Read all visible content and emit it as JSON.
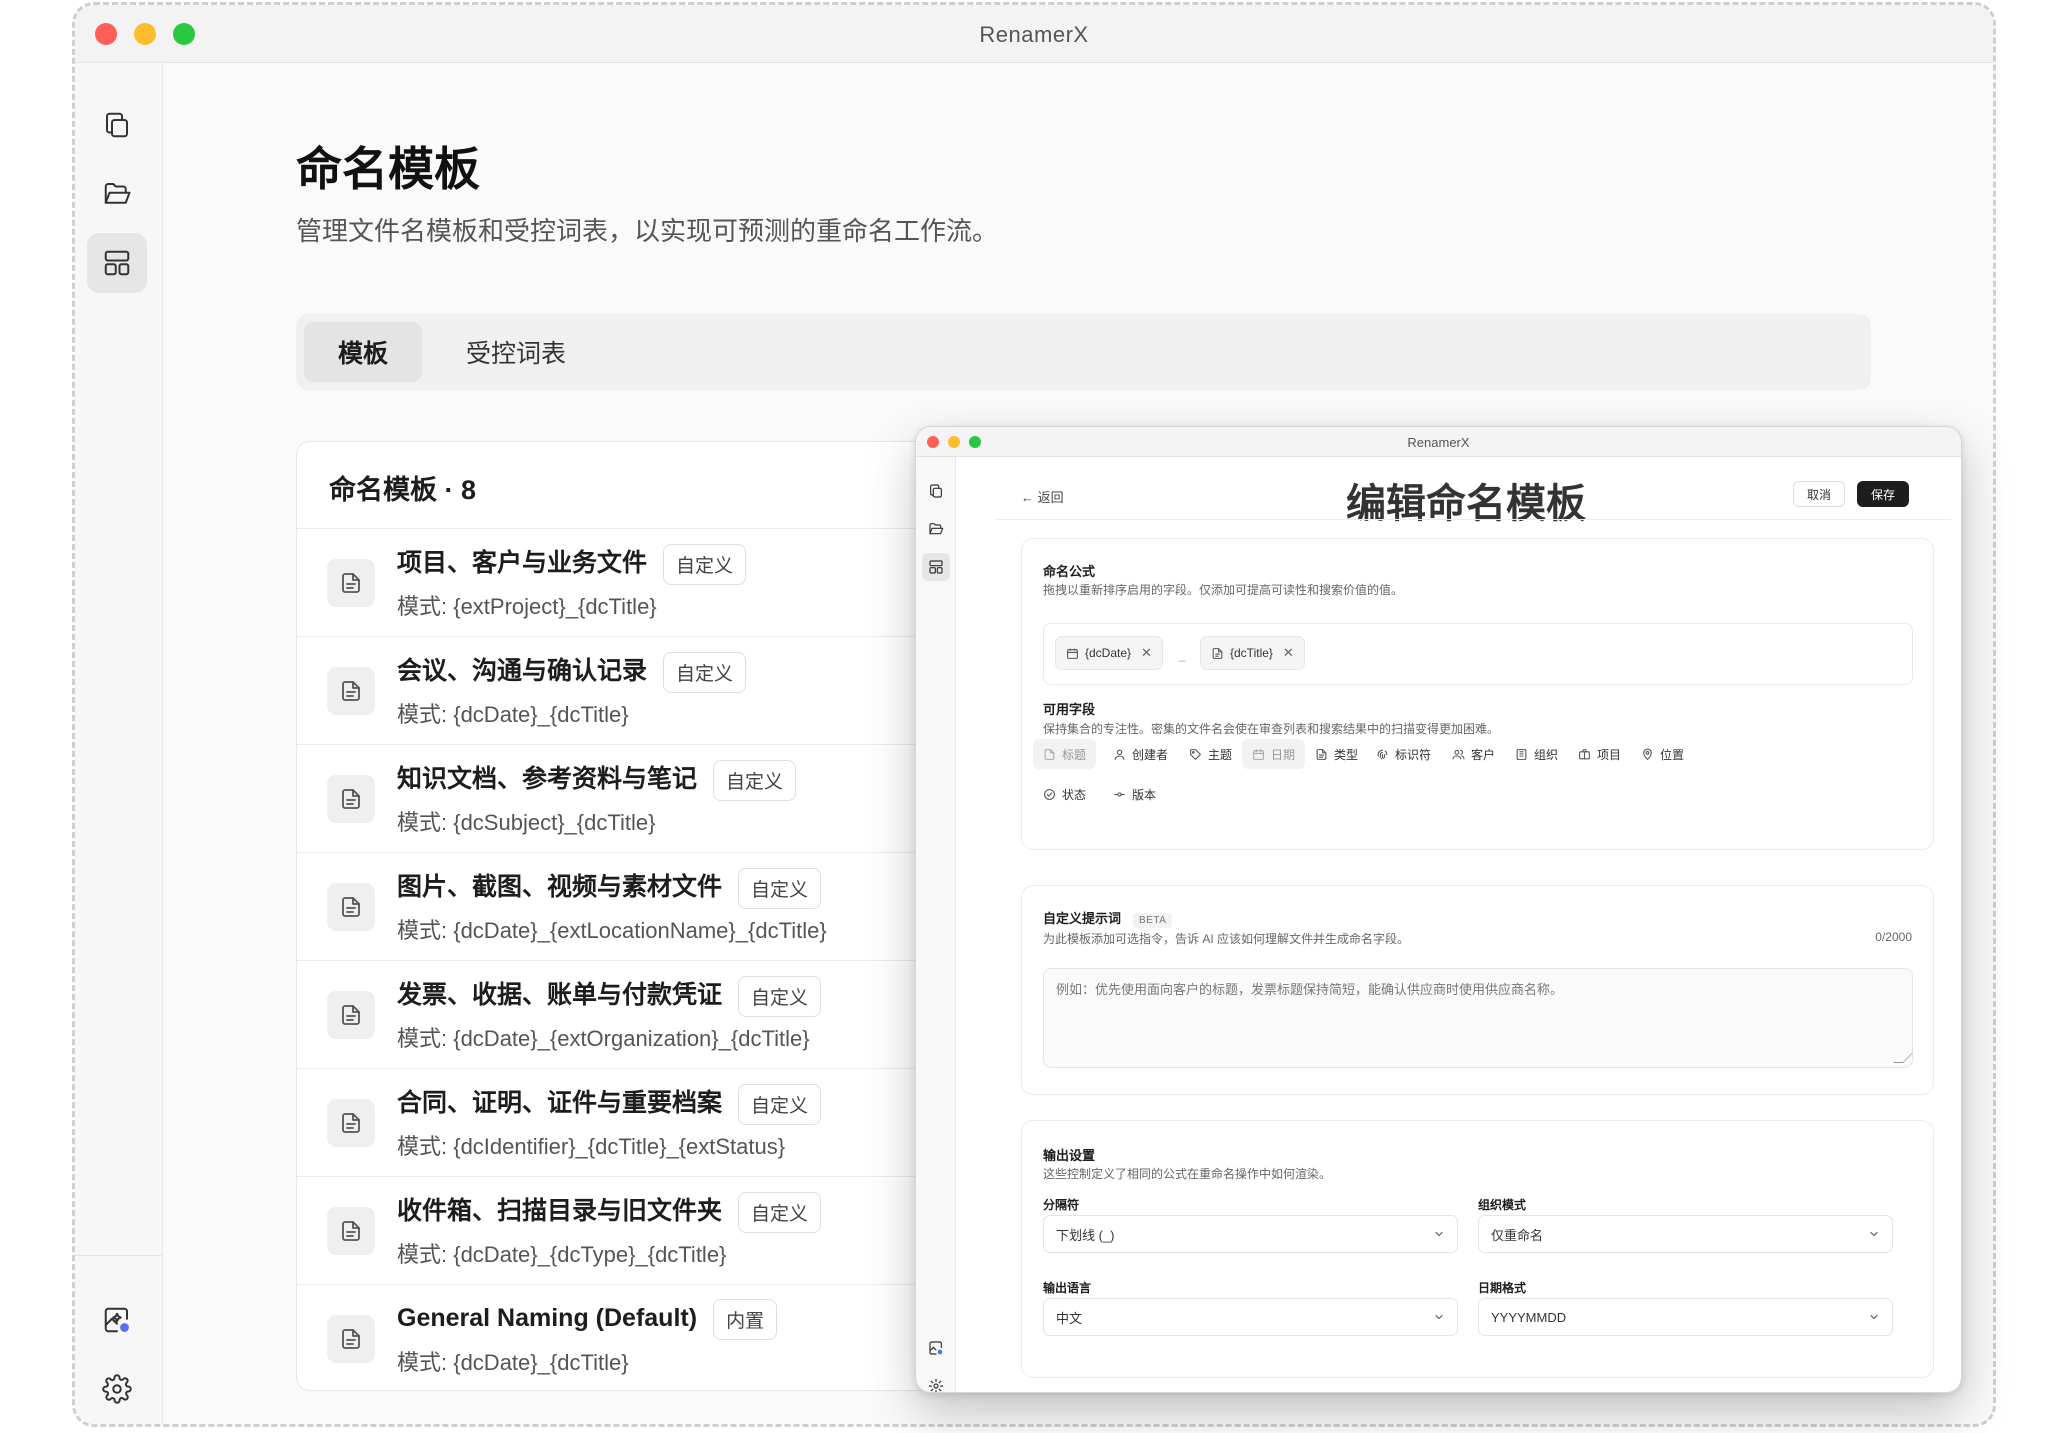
{
  "window": {
    "title": "RenamerX"
  },
  "sidebar": {
    "icons": [
      "files-icon",
      "folder-open-icon",
      "templates-icon",
      "image-ai-icon",
      "gear-icon"
    ]
  },
  "page": {
    "title": "命名模板",
    "subtitle": "管理文件名模板和受控词表，以实现可预测的重命名工作流。"
  },
  "tabs": [
    {
      "label": "模板",
      "active": true
    },
    {
      "label": "受控词表",
      "active": false
    }
  ],
  "templates": {
    "header": "命名模板 · 8",
    "items": [
      {
        "name": "项目、客户与业务文件",
        "badge": "自定义",
        "pattern": "模式: {extProject}_{dcTitle}"
      },
      {
        "name": "会议、沟通与确认记录",
        "badge": "自定义",
        "pattern": "模式: {dcDate}_{dcTitle}"
      },
      {
        "name": "知识文档、参考资料与笔记",
        "badge": "自定义",
        "pattern": "模式: {dcSubject}_{dcTitle}"
      },
      {
        "name": "图片、截图、视频与素材文件",
        "badge": "自定义",
        "pattern": "模式: {dcDate}_{extLocationName}_{dcTitle}"
      },
      {
        "name": "发票、收据、账单与付款凭证",
        "badge": "自定义",
        "pattern": "模式: {dcDate}_{extOrganization}_{dcTitle}"
      },
      {
        "name": "合同、证明、证件与重要档案",
        "badge": "自定义",
        "pattern": "模式: {dcIdentifier}_{dcTitle}_{extStatus}"
      },
      {
        "name": "收件箱、扫描目录与旧文件夹",
        "badge": "自定义",
        "pattern": "模式: {dcDate}_{dcType}_{dcTitle}"
      },
      {
        "name": "General Naming (Default)",
        "badge": "内置",
        "pattern": "模式: {dcDate}_{dcTitle}"
      }
    ]
  },
  "editor": {
    "window_title": "RenamerX",
    "back_label": "← 返回",
    "heading": "编辑命名模板",
    "cancel_label": "取消",
    "save_label": "保存",
    "formula": {
      "title": "命名公式",
      "desc": "拖拽以重新排序启用的字段。仅添加可提高可读性和搜索价值的值。",
      "chips": [
        "{dcDate}",
        "{dcTitle}"
      ],
      "separator": "_"
    },
    "available": {
      "title": "可用字段",
      "desc": "保持集合的专注性。密集的文件名会使在审查列表和搜索结果中的扫描变得更加困难。",
      "fields": [
        {
          "label": "标题",
          "icon": "file-icon",
          "used": true
        },
        {
          "label": "创建者",
          "icon": "user-icon",
          "used": false
        },
        {
          "label": "主题",
          "icon": "tag-icon",
          "used": false
        },
        {
          "label": "日期",
          "icon": "calendar-icon",
          "used": true
        },
        {
          "label": "类型",
          "icon": "file-type-icon",
          "used": false
        },
        {
          "label": "标识符",
          "icon": "fingerprint-icon",
          "used": false
        },
        {
          "label": "客户",
          "icon": "users-icon",
          "used": false
        },
        {
          "label": "组织",
          "icon": "building-icon",
          "used": false
        },
        {
          "label": "项目",
          "icon": "briefcase-icon",
          "used": false
        },
        {
          "label": "位置",
          "icon": "map-pin-icon",
          "used": false
        },
        {
          "label": "状态",
          "icon": "check-circle-icon",
          "used": false
        },
        {
          "label": "版本",
          "icon": "git-commit-icon",
          "used": false
        }
      ]
    },
    "prompt": {
      "title": "自定义提示词",
      "beta": "BETA",
      "desc": "为此模板添加可选指令，告诉 AI 应该如何理解文件并生成命名字段。",
      "counter": "0/2000",
      "placeholder": "例如：优先使用面向客户的标题，发票标题保持简短，能确认供应商时使用供应商名称。"
    },
    "output": {
      "title": "输出设置",
      "desc": "这些控制定义了相同的公式在重命名操作中如何渲染。",
      "separator_label": "分隔符",
      "separator_value": "下划线 (_)",
      "mode_label": "组织模式",
      "mode_value": "仅重命名",
      "language_label": "输出语言",
      "language_value": "中文",
      "date_label": "日期格式",
      "date_value": "YYYYMMDD"
    }
  }
}
